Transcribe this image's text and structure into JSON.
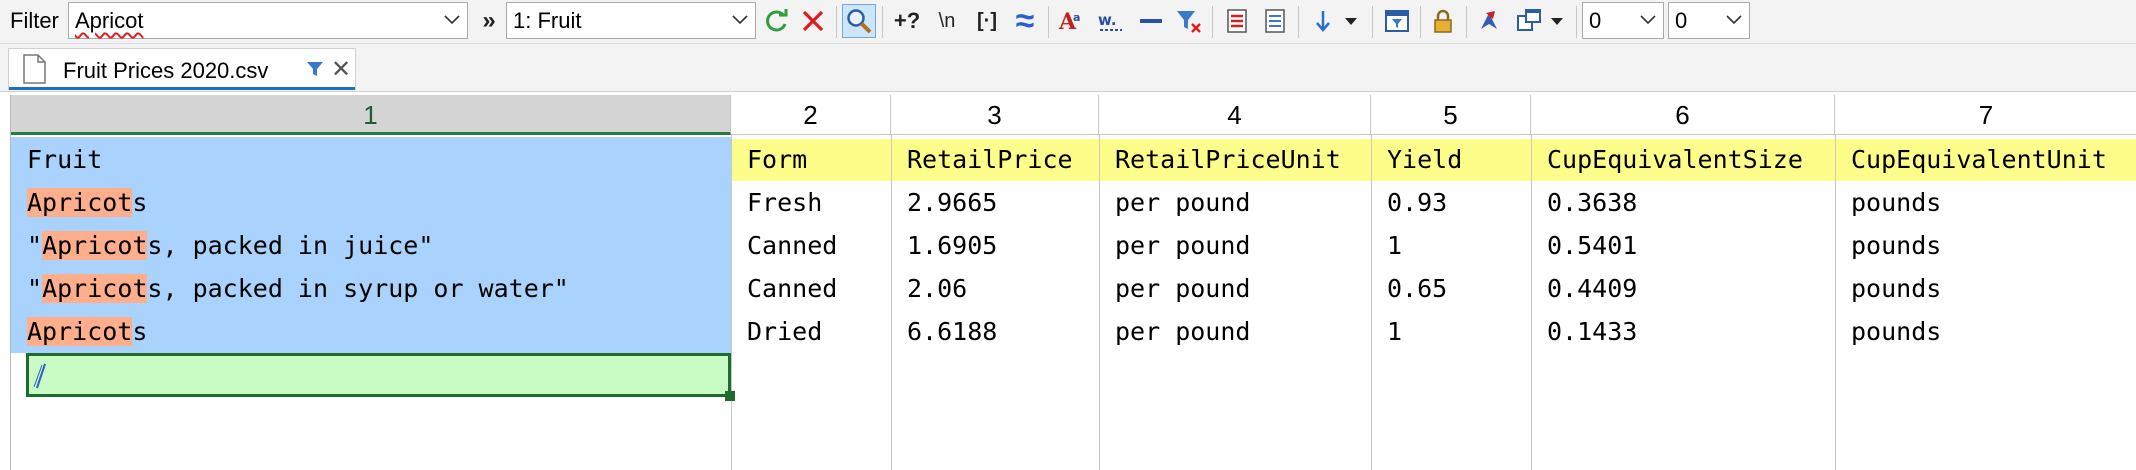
{
  "toolbar": {
    "filter_label": "Filter",
    "filter_value": "Apricot",
    "expand_glyph": "»",
    "column_select": "1: Fruit",
    "refresh_icon": "refresh-icon",
    "clear_icon": "x-clear-icon",
    "search_icon": "magnifier-icon",
    "btn_plus_q": "+?",
    "btn_newline": "\\n",
    "btn_brackets": "[·]",
    "fuzzy_glyph": "≈",
    "num_left": "0",
    "num_right": "0"
  },
  "tab": {
    "title": "Fruit Prices 2020.csv",
    "doc_icon": "document-icon",
    "filter_icon": "funnel-icon",
    "close_glyph": "✕"
  },
  "grid": {
    "column_numbers": [
      "1",
      "2",
      "3",
      "4",
      "5",
      "6",
      "7"
    ],
    "rows": [
      {
        "pre": "",
        "match": "",
        "post": "Fruit",
        "cells": [
          "Form",
          "RetailPrice",
          "RetailPriceUnit",
          "Yield",
          "CupEquivalentSize",
          "CupEquivalentUnit"
        ]
      },
      {
        "pre": "",
        "match": "Apricot",
        "post": "s",
        "cells": [
          "Fresh",
          "2.9665",
          "per pound",
          "0.93",
          "0.3638",
          "pounds"
        ]
      },
      {
        "pre": "\"",
        "match": "Apricot",
        "post": "s, packed in juice\"",
        "cells": [
          "Canned",
          "1.6905",
          "per pound",
          "1",
          "0.5401",
          "pounds"
        ]
      },
      {
        "pre": "\"",
        "match": "Apricot",
        "post": "s, packed in syrup or water\"",
        "cells": [
          "Canned",
          "2.06",
          "per pound",
          "0.65",
          "0.4409",
          "pounds"
        ]
      },
      {
        "pre": "",
        "match": "Apricot",
        "post": "s",
        "cells": [
          "Dried",
          "6.6188",
          "per pound",
          "1",
          "0.1433",
          "pounds"
        ]
      }
    ]
  },
  "colors": {
    "selected_column": "#a9d2fc",
    "match_highlight": "#ffae8c",
    "header_row_highlight": "#fdfd8a",
    "active_cell": "#c9fcc4"
  }
}
